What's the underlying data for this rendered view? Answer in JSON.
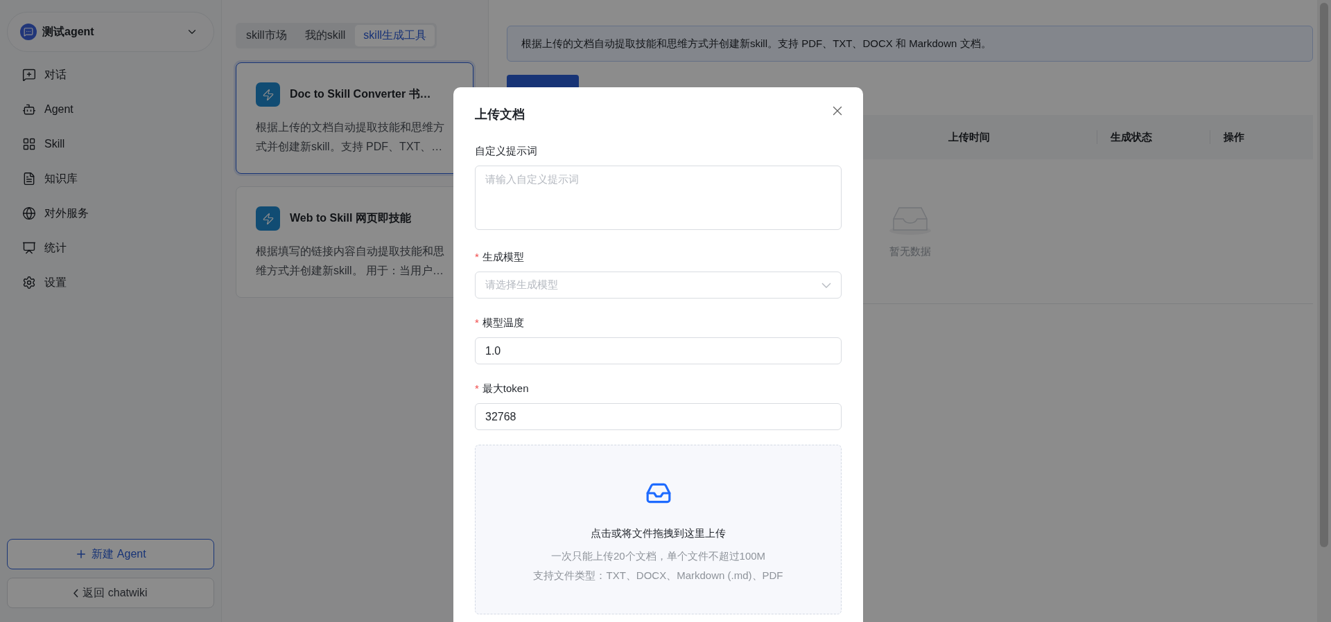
{
  "agent_selector": {
    "name": "测试agent"
  },
  "sidebar": {
    "items": [
      {
        "kind": "chat",
        "label": "对话"
      },
      {
        "kind": "agent",
        "label": "Agent"
      },
      {
        "kind": "skill",
        "label": "Skill"
      },
      {
        "kind": "knowledge",
        "label": "知识库"
      },
      {
        "kind": "service",
        "label": "对外服务"
      },
      {
        "kind": "stats",
        "label": "统计"
      },
      {
        "kind": "settings",
        "label": "设置"
      }
    ]
  },
  "sidebar_buttons": {
    "new_agent": "新建 Agent",
    "back": "返回 chatwiki"
  },
  "tabs": [
    {
      "label": "skill市场",
      "selected": false
    },
    {
      "label": "我的skill",
      "selected": false
    },
    {
      "label": "skill生成工具",
      "selected": true
    }
  ],
  "tool_cards": [
    {
      "title": "Doc to Skill Converter 书…",
      "description": "根据上传的文档自动提取技能和思维方式并创建新skill。支持 PDF、TXT、…",
      "selected": true
    },
    {
      "title": "Web to Skill 网页即技能",
      "description": "根据填写的链接内容自动提取技能和思维方式并创建新skill。 用于：当用户…",
      "selected": false
    }
  ],
  "banner": "根据上传的文档自动提取技能和思维方式并创建新skill。支持 PDF、TXT、DOCX 和 Markdown 文档。",
  "table": {
    "columns": [
      "上传时间",
      "生成状态",
      "操作"
    ],
    "empty_text": "暂无数据"
  },
  "modal": {
    "title": "上传文档",
    "fields": [
      {
        "kind": "textarea",
        "label": "自定义提示词",
        "placeholder": "请输入自定义提示词"
      },
      {
        "kind": "select",
        "label": "生成模型",
        "required_mark": "*",
        "placeholder": "请选择生成模型"
      },
      {
        "kind": "input",
        "label": "模型温度",
        "required_mark": "*",
        "value": "1.0"
      },
      {
        "kind": "input",
        "label": "最大token",
        "required_mark": "*",
        "value": "32768"
      }
    ],
    "upload": {
      "title": "点击或将文件拖拽到这里上传",
      "hint": "一次只能上传20个文档，单个文件不超过100M",
      "types": "支持文件类型：TXT、DOCX、Markdown (.md)、PDF"
    }
  }
}
